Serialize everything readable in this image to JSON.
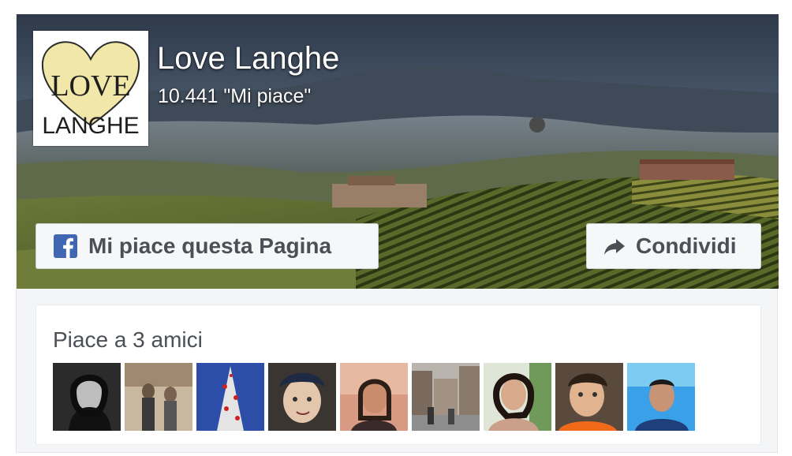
{
  "page": {
    "name": "Love Langhe",
    "likes": "10.441 \"Mi piace\"",
    "logo_text_top": "LOVE",
    "logo_text_bottom": "LANGHE"
  },
  "buttons": {
    "like_label": "Mi piace questa Pagina",
    "share_label": "Condividi"
  },
  "friends": {
    "label": "Piace a 3 amici",
    "avatars": [
      {
        "name": "friend-avatar-1"
      },
      {
        "name": "friend-avatar-2"
      },
      {
        "name": "friend-avatar-3"
      },
      {
        "name": "friend-avatar-4"
      },
      {
        "name": "friend-avatar-5"
      },
      {
        "name": "friend-avatar-6"
      },
      {
        "name": "friend-avatar-7"
      },
      {
        "name": "friend-avatar-8"
      },
      {
        "name": "friend-avatar-9"
      }
    ]
  },
  "icons": {
    "facebook": "facebook-f-icon",
    "share": "share-arrow-icon"
  },
  "colors": {
    "facebook_blue": "#4267b2",
    "button_text": "#4b4f56",
    "button_bg": "#f6f7f9",
    "panel_bg": "#f4f5f7"
  }
}
